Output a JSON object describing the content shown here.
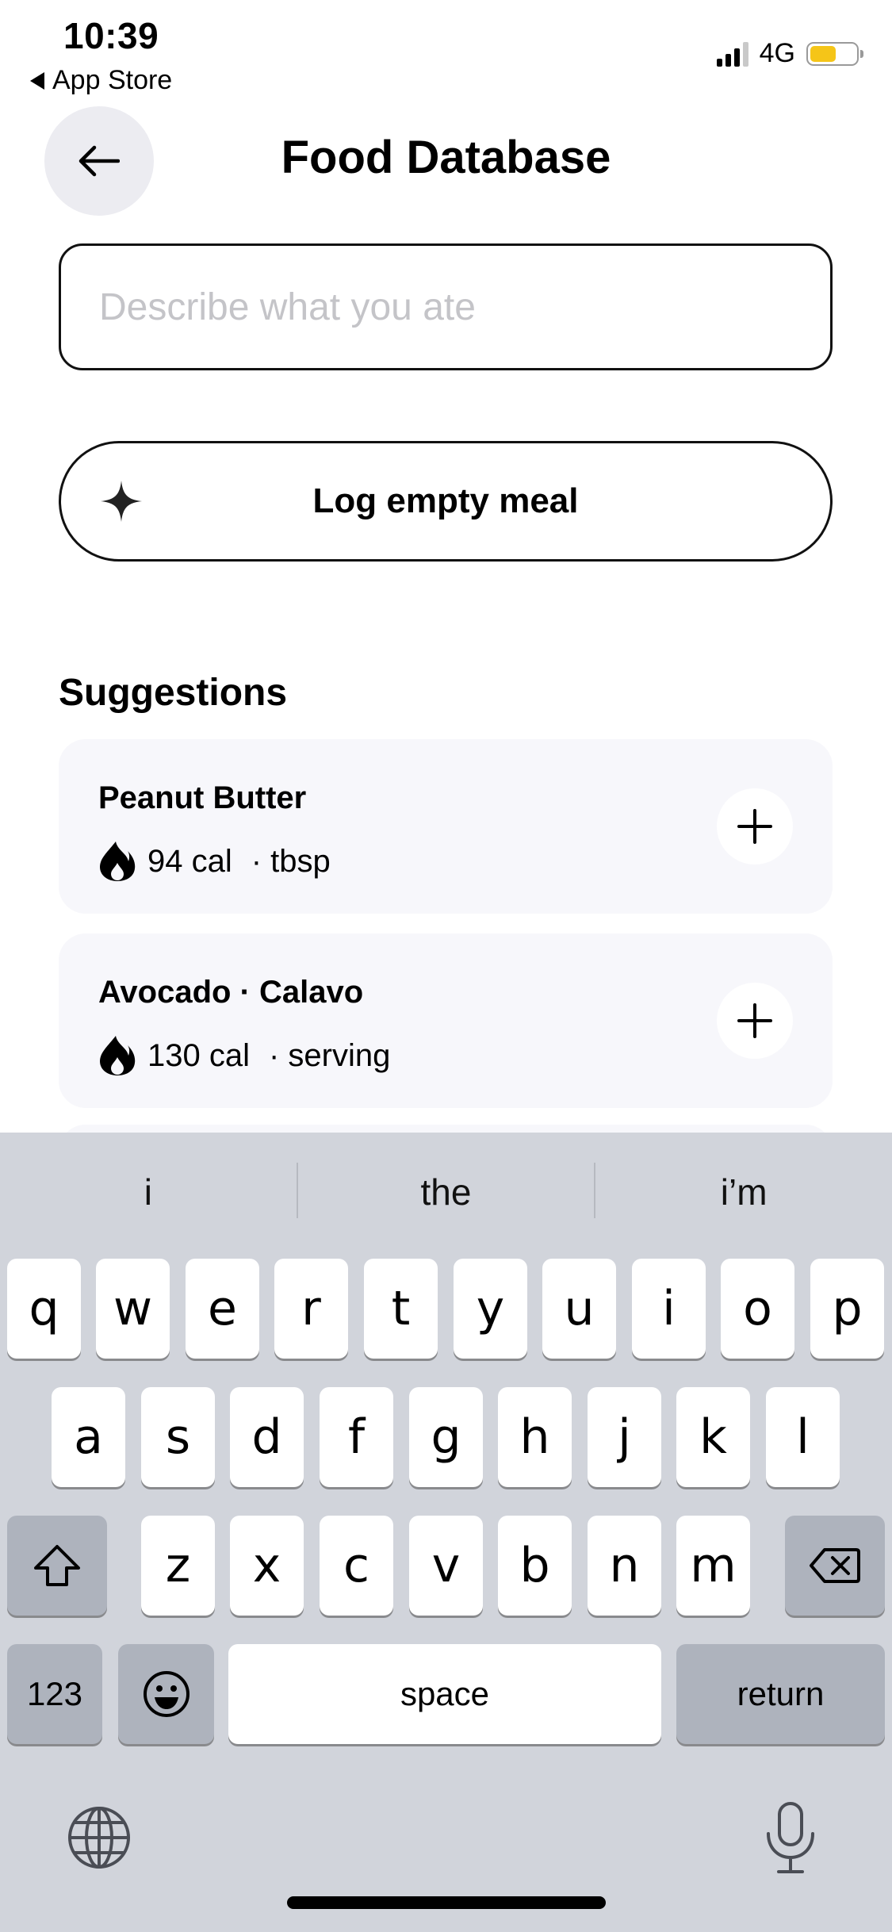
{
  "status_bar": {
    "time": "10:39",
    "back_app": "App Store",
    "network": "4G",
    "battery_color": "#f5c518"
  },
  "header": {
    "title": "Food Database",
    "back_icon": "arrow-left-icon"
  },
  "search": {
    "placeholder": "Describe what you ate",
    "value": ""
  },
  "log_empty_meal": {
    "label": "Log empty meal",
    "icon": "sparkle-icon"
  },
  "suggestions": {
    "title": "Suggestions",
    "items": [
      {
        "name": "Peanut Butter",
        "calories": "94 cal",
        "unit": "· tbsp"
      },
      {
        "name": "Avocado · Calavo",
        "calories": "130 cal",
        "unit": "· serving"
      }
    ]
  },
  "keyboard": {
    "predictions": [
      "i",
      "the",
      "i’m"
    ],
    "row1": [
      "q",
      "w",
      "e",
      "r",
      "t",
      "y",
      "u",
      "i",
      "o",
      "p"
    ],
    "row2": [
      "a",
      "s",
      "d",
      "f",
      "g",
      "h",
      "j",
      "k",
      "l"
    ],
    "row3": [
      "z",
      "x",
      "c",
      "v",
      "b",
      "n",
      "m"
    ],
    "numbers_label": "123",
    "space_label": "space",
    "return_label": "return"
  }
}
